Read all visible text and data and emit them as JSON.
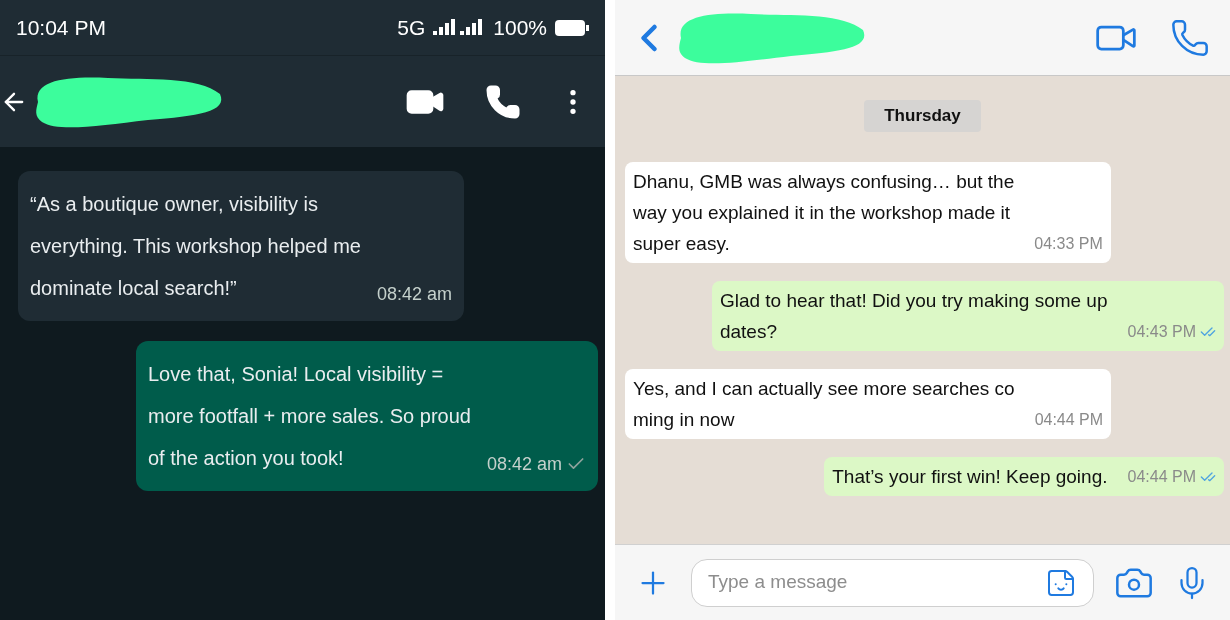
{
  "left_chat": {
    "status_bar": {
      "time": "10:04 PM",
      "network": "5G",
      "battery": "100%"
    },
    "messages": [
      {
        "kind": "incoming",
        "lines": [
          "“As a boutique owner, visibility is",
          "everything. This workshop helped me",
          "dominate local search!”"
        ],
        "time": "08:42 am"
      },
      {
        "kind": "outgoing",
        "lines": [
          "Love that, Sonia! Local visibility =",
          "more footfall + more sales. So proud",
          "of the action you took!"
        ],
        "time": "08:42 am",
        "read": false
      }
    ]
  },
  "right_chat": {
    "date_label": "Thursday",
    "messages": [
      {
        "kind": "incoming",
        "lines": [
          "Dhanu, GMB was always confusing… but the",
          "way you explained it in the workshop made it",
          "super easy."
        ],
        "time": "04:33 PM"
      },
      {
        "kind": "outgoing",
        "lines": [
          "Glad to hear that! Did you try making some up",
          "dates?"
        ],
        "time": "04:43 PM",
        "read": true
      },
      {
        "kind": "incoming",
        "lines": [
          "Yes, and I can actually see more searches co",
          "ming in now"
        ],
        "time": "04:44 PM"
      },
      {
        "kind": "outgoing",
        "lines": [
          "That’s your first win! Keep going."
        ],
        "time": "04:44 PM",
        "read": true
      }
    ],
    "composer": {
      "placeholder": "Type a message"
    }
  }
}
